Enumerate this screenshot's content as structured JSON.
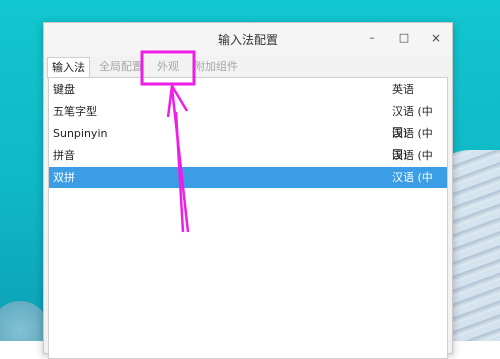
{
  "window": {
    "title": "输入法配置",
    "controls": {
      "minimize": "–",
      "maximize": "□",
      "close": "×"
    }
  },
  "tabs": [
    {
      "label": "输入法",
      "active": true
    },
    {
      "label": "全局配置",
      "active": false
    },
    {
      "label": "外观",
      "active": false
    },
    {
      "label": "附加组件",
      "active": false
    }
  ],
  "input_methods": [
    {
      "name": "键盘",
      "language": "英语",
      "selected": false
    },
    {
      "name": "五笔字型",
      "language": "汉语 (中国)",
      "selected": false
    },
    {
      "name": "Sunpinyin",
      "language": "汉语 (中国)",
      "selected": false
    },
    {
      "name": "拼音",
      "language": "汉语 (中国)",
      "selected": false
    },
    {
      "name": "双拼",
      "language": "汉语 (中国)",
      "selected": true
    }
  ],
  "colors": {
    "selection": "#3a9de6",
    "annotation": "#ee1ee6",
    "desktop": "#12c6cf"
  },
  "icons": [
    "minimize-icon",
    "maximize-icon",
    "close-icon"
  ]
}
